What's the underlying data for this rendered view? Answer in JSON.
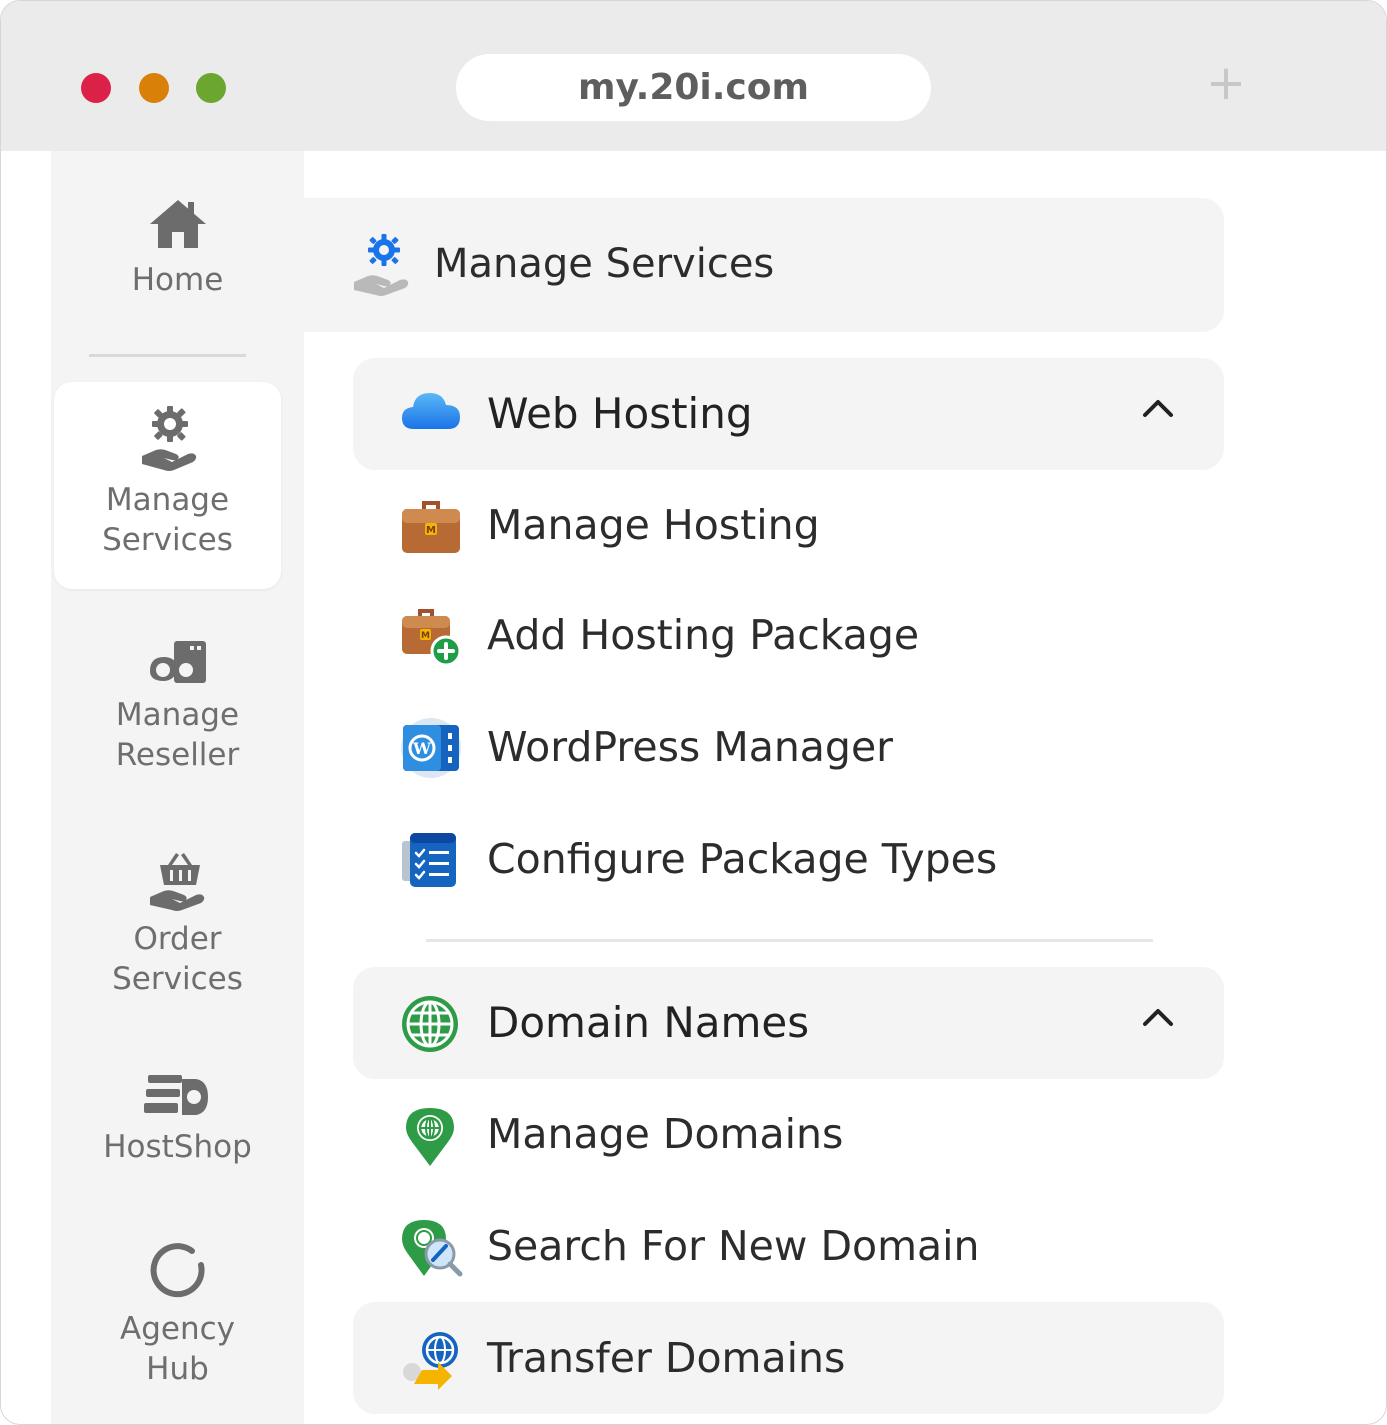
{
  "browser": {
    "url": "my.20i.com",
    "new_tab_symbol": "+",
    "traffic_lights": [
      "#dc2148",
      "#d98008",
      "#6ba72f"
    ]
  },
  "sidebar": {
    "items": [
      {
        "label": "Home",
        "icon": "home-icon"
      },
      {
        "label": "Manage\nServices",
        "icon": "hand-gear-icon",
        "active": true
      },
      {
        "label": "Manage\nReseller",
        "icon": "reseller-icon"
      },
      {
        "label": "Order\nServices",
        "icon": "hand-basket-icon"
      },
      {
        "label": "HostShop",
        "icon": "hostshop-icon"
      },
      {
        "label": "Agency\nHub",
        "icon": "agency-hub-icon"
      }
    ]
  },
  "main": {
    "header": {
      "title": "Manage Services",
      "icon": "hand-gear-icon"
    },
    "groups": [
      {
        "title": "Web Hosting",
        "icon": "cloud-icon",
        "expanded": true,
        "items": [
          {
            "label": "Manage Hosting",
            "icon": "briefcase-icon"
          },
          {
            "label": "Add Hosting Package",
            "icon": "briefcase-add-icon"
          },
          {
            "label": "WordPress Manager",
            "icon": "wordpress-icon"
          },
          {
            "label": "Configure Package Types",
            "icon": "checklist-icon"
          }
        ]
      },
      {
        "title": "Domain Names",
        "icon": "globe-icon",
        "expanded": true,
        "items": [
          {
            "label": "Manage Domains",
            "icon": "globe-pin-icon"
          },
          {
            "label": "Search For New Domain",
            "icon": "globe-search-icon"
          },
          {
            "label": "Transfer Domains",
            "icon": "globe-transfer-icon"
          }
        ]
      }
    ]
  },
  "colors": {
    "accent_blue": "#1a73e8",
    "sidebar_bg": "#f4f4f4",
    "text_dark": "#2c2c2c",
    "text_muted": "#6e6e6e"
  }
}
